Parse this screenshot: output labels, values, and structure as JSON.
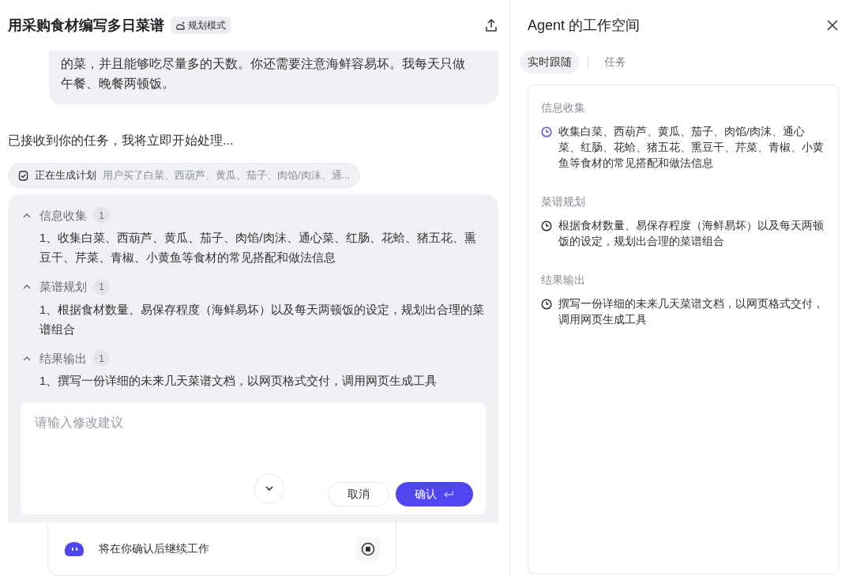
{
  "chat": {
    "title": "用采购食材编写多日菜谱",
    "mode_badge": "规划模式",
    "user_message": "的菜，并且能够吃尽量多的天数。你还需要注意海鲜容易坏。我每天只做午餐、晚餐两顿饭。",
    "assistant_message": "已接收到你的任务，我将立即开始处理...",
    "plan_status": {
      "label": "正在生成计划",
      "summary": "用户买了白菜、西葫芦、黄瓜、茄子、肉馅/肉沫、通..."
    },
    "plan_sections": [
      {
        "title": "信息收集",
        "count": "1",
        "expanded": true,
        "steps": [
          "1、收集白菜、西葫芦、黄瓜、茄子、肉馅/肉沫、通心菜、红肠、花蛤、猪五花、熏豆干、芹菜、青椒、小黄鱼等食材的常见搭配和做法信息"
        ]
      },
      {
        "title": "菜谱规划",
        "count": "1",
        "expanded": true,
        "steps": [
          "1、根据食材数量、易保存程度（海鲜易坏）以及每天两顿饭的设定，规划出合理的菜谱组合"
        ]
      },
      {
        "title": "结果输出",
        "count": "1",
        "expanded": true,
        "steps": [
          "1、撰写一份详细的未来几天菜谱文档，以网页格式交付，调用网页生成工具"
        ]
      }
    ],
    "suggestion_input": {
      "placeholder": "请输入修改建议"
    },
    "buttons": [
      {
        "label": "取消",
        "kind": "secondary"
      },
      {
        "label": "确认",
        "kind": "primary"
      }
    ],
    "status_bar": {
      "text": "将在你确认后继续工作"
    }
  },
  "workspace": {
    "title": "Agent 的工作空间",
    "tabs": [
      {
        "label": "实时跟随",
        "selected": true
      },
      {
        "label": "任务",
        "selected": false
      }
    ],
    "groups": [
      {
        "title": "信息收集",
        "tasks": [
          {
            "text": "收集白菜、西葫芦、黄瓜、茄子、肉馅/肉沫、通心菜、红肠、花蛤、猪五花、熏豆干、芹菜、青椒、小黄鱼等食材的常见搭配和做法信息",
            "active": true
          }
        ]
      },
      {
        "title": "菜谱规划",
        "tasks": [
          {
            "text": "根据食材数量、易保存程度（海鲜易坏）以及每天两顿饭的设定，规划出合理的菜谱组合",
            "active": false
          }
        ]
      },
      {
        "title": "结果输出",
        "tasks": [
          {
            "text": "撰写一份详细的未来几天菜谱文档，以网页格式交付，调用网页生成工具",
            "active": false
          }
        ]
      }
    ]
  }
}
